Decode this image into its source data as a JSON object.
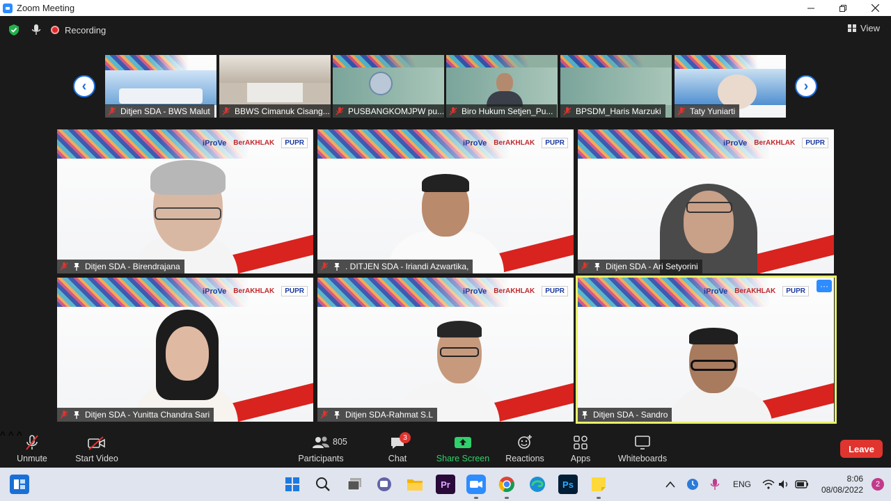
{
  "window": {
    "title": "Zoom Meeting",
    "controls": [
      "minimize",
      "restore",
      "close"
    ]
  },
  "topbar": {
    "recording_label": "Recording",
    "view_label": "View"
  },
  "filmstrip": [
    {
      "name": "Ditjen SDA - BWS Malut"
    },
    {
      "name": "BBWS Cimanuk Cisang..."
    },
    {
      "name": "PUSBANGKOMJPW pu..."
    },
    {
      "name": "Biro Hukum Setjen_Pu..."
    },
    {
      "name": "BPSDM_Haris Marzuki"
    },
    {
      "name": "Taty Yuniarti"
    }
  ],
  "tiles": [
    {
      "name": "Ditjen SDA - Birendrajana"
    },
    {
      "name": ". DITJEN SDA -  Iriandi  Azwartika,"
    },
    {
      "name": "Ditjen SDA - Ari Setyorini"
    },
    {
      "name": "Ditjen SDA - Yunitta Chandra Sari"
    },
    {
      "name": "Ditjen SDA-Rahmat S.L"
    },
    {
      "name": "Ditjen SDA - Sandro"
    }
  ],
  "banner_logos": {
    "iprove": "iProVe",
    "berakhlak": "BerAKHLAK",
    "pupr": "PUPR"
  },
  "toolbar": {
    "unmute": "Unmute",
    "start_video": "Start Video",
    "participants": "Participants",
    "participants_count": "805",
    "chat": "Chat",
    "chat_badge": "3",
    "share_screen": "Share Screen",
    "reactions": "Reactions",
    "apps": "Apps",
    "whiteboards": "Whiteboards",
    "leave": "Leave"
  },
  "taskbar": {
    "language": "ENG",
    "time": "8:06",
    "date": "08/08/2022",
    "notifications": "2"
  },
  "colors": {
    "accent": "#2d8cff",
    "leave": "#e0342f",
    "share": "#2fd16a",
    "active_speaker": "#e8f06a"
  }
}
